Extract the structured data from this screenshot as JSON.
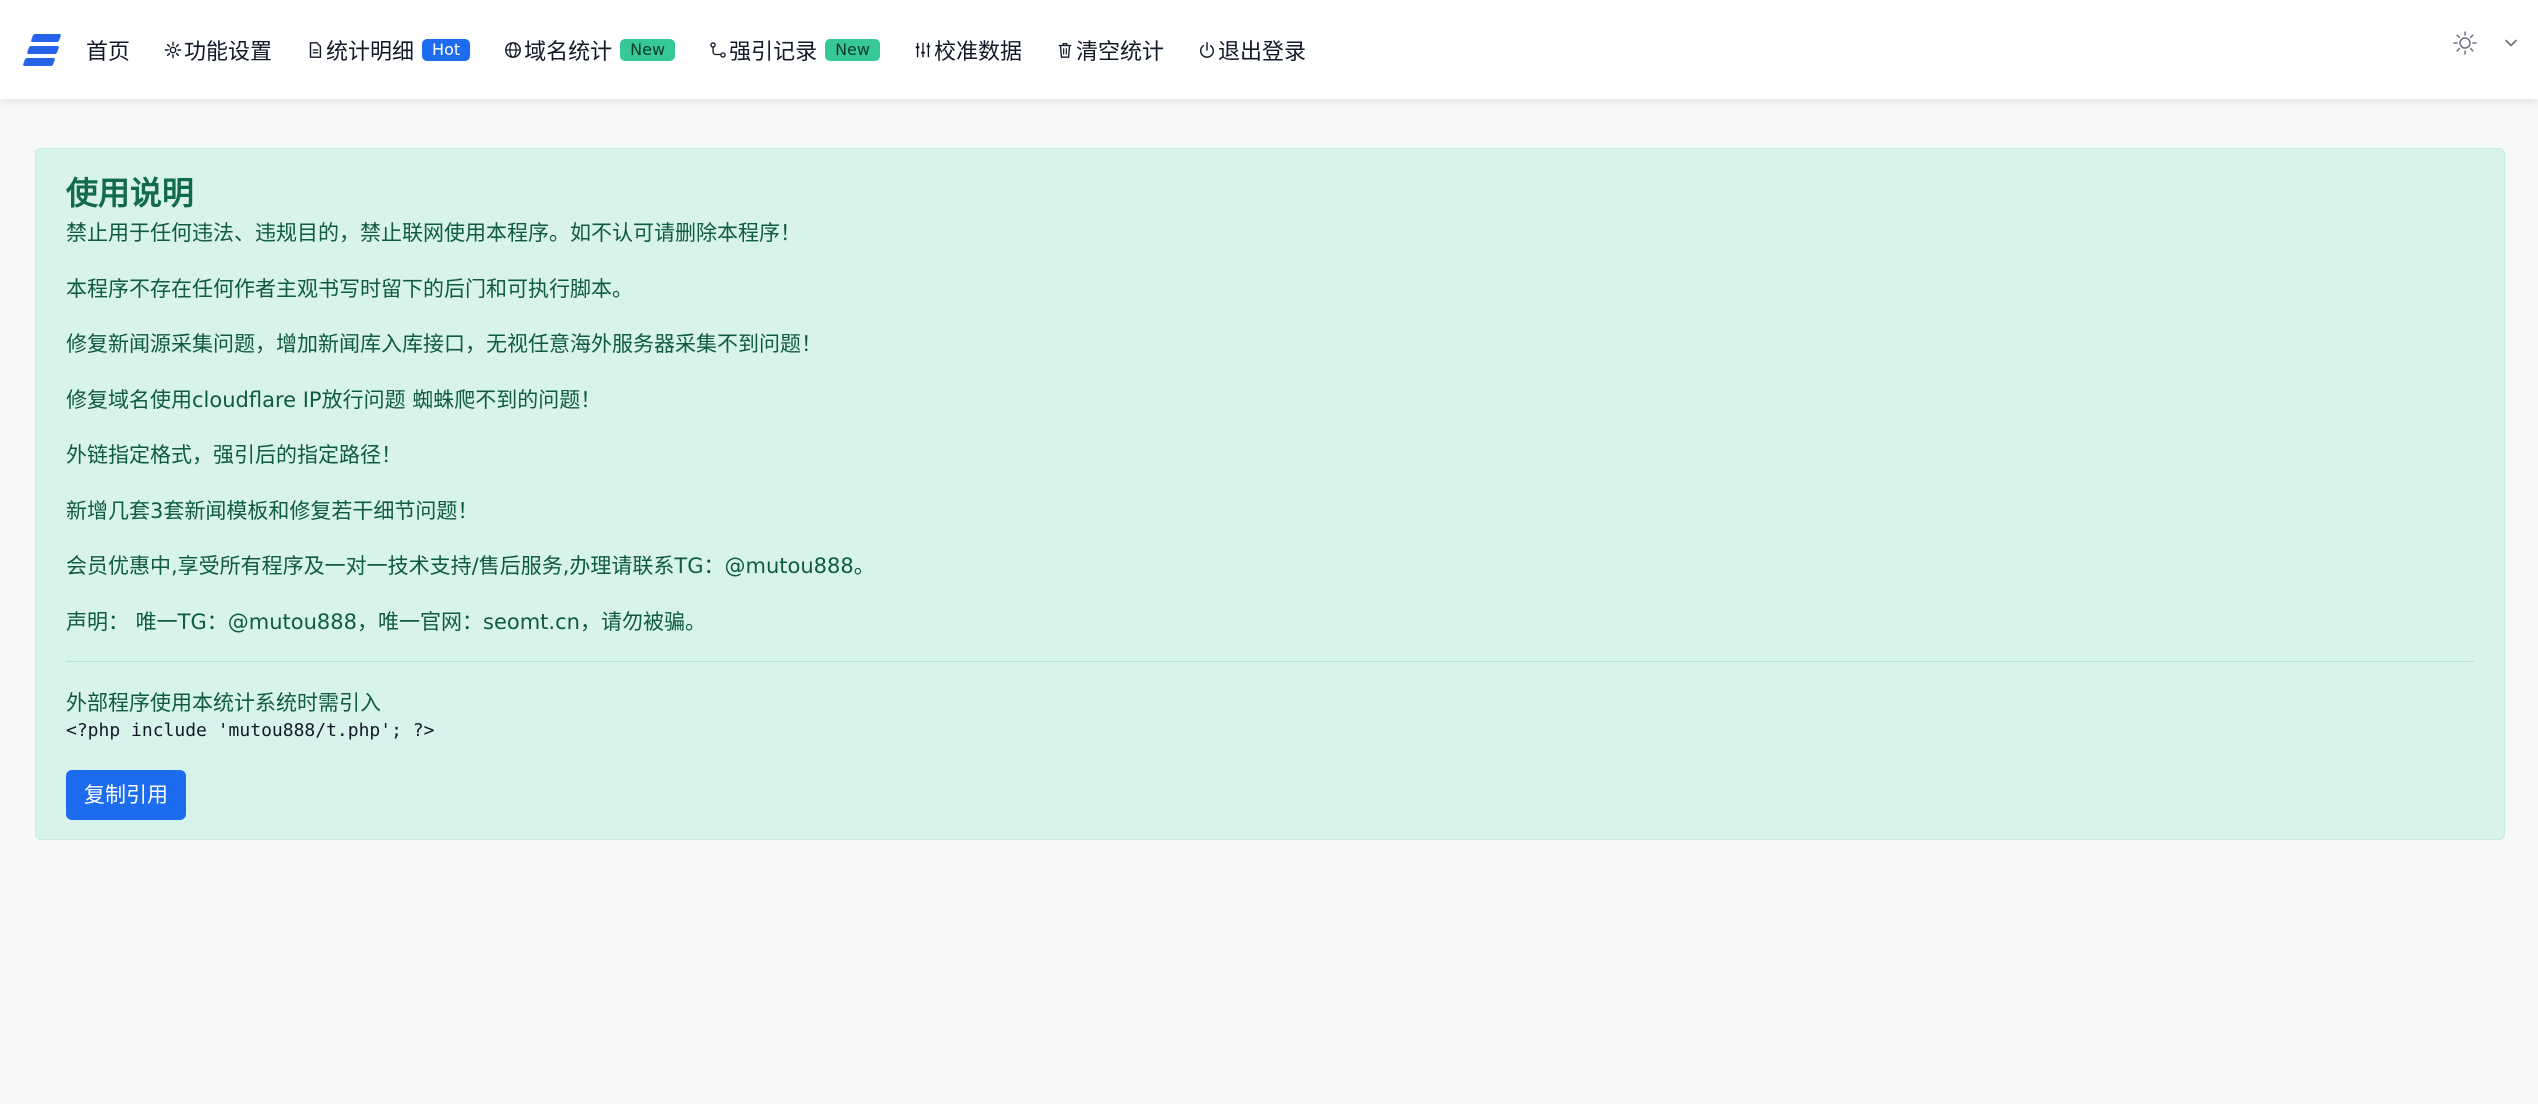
{
  "nav": {
    "home": "首页",
    "items": [
      {
        "icon": "gear-icon",
        "label": "功能设置",
        "badge": ""
      },
      {
        "icon": "document-icon",
        "label": "统计明细",
        "badge": "Hot"
      },
      {
        "icon": "globe-icon",
        "label": "域名统计",
        "badge": "New"
      },
      {
        "icon": "link-icon",
        "label": "强引记录",
        "badge": "New"
      },
      {
        "icon": "sliders-icon",
        "label": "校准数据",
        "badge": ""
      },
      {
        "icon": "trash-icon",
        "label": "清空统计",
        "badge": ""
      },
      {
        "icon": "power-icon",
        "label": "退出登录",
        "badge": ""
      }
    ]
  },
  "notice": {
    "title": "使用说明",
    "lines": [
      "禁止用于任何违法、违规目的，禁止联网使用本程序。如不认可请删除本程序！",
      "本程序不存在任何作者主观书写时留下的后门和可执行脚本。",
      "修复新闻源采集问题，增加新闻库入库接口，无视任意海外服务器采集不到问题！",
      "修复域名使用cloudflare IP放行问题 蜘蛛爬不到的问题！",
      "外链指定格式，强引后的指定路径！",
      "新增几套3套新闻模板和修复若干细节问题！",
      "会员优惠中,享受所有程序及一对一技术支持/售后服务,办理请联系TG：@mutou888。",
      "声明： 唯一TG：@mutou888，唯一官网：seomt.cn，请勿被骗。"
    ],
    "external_label": "外部程序使用本统计系统时需引入",
    "code": "<?php include 'mutou888/t.php'; ?>",
    "copy_button": "复制引用"
  },
  "colors": {
    "accent": "#1d6cf0",
    "card_bg": "#d8f3eb",
    "card_text": "#0f5a43",
    "badge_new": "#36c995"
  }
}
